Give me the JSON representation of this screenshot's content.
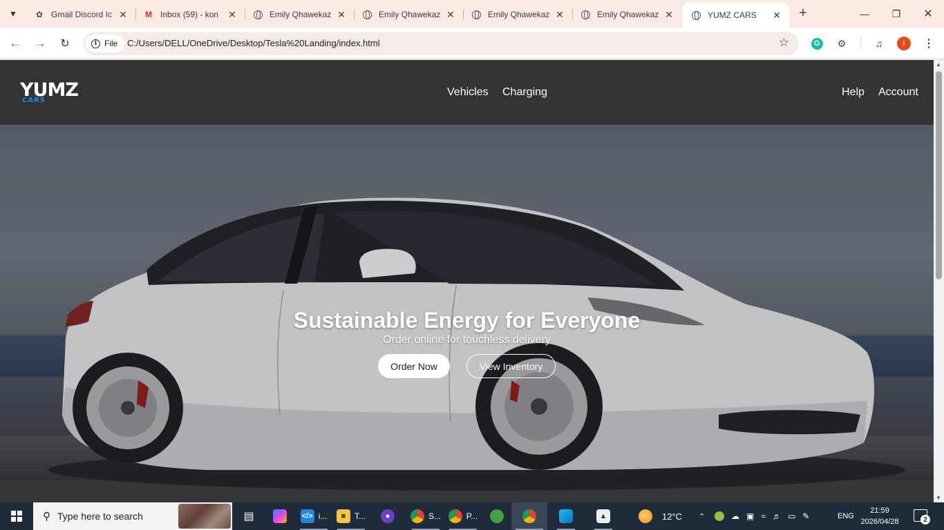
{
  "browser": {
    "tabs": [
      {
        "title": "Gmail Discord Ic",
        "icon": "chatgpt-icon"
      },
      {
        "title": "Inbox (59) - kon",
        "icon": "gmail-icon"
      },
      {
        "title": "Emily Qhawekaz",
        "icon": "globe-icon"
      },
      {
        "title": "Emily Qhawekaz",
        "icon": "globe-icon"
      },
      {
        "title": "Emily Qhawekaz",
        "icon": "globe-icon"
      },
      {
        "title": "Emily Qhawekaz",
        "icon": "globe-icon"
      },
      {
        "title": "YUMZ CARS",
        "icon": "globe-icon",
        "active": true
      }
    ],
    "omnibox": {
      "scheme_label": "File",
      "url": "C:/Users/DELL/OneDrive/Desktop/Tesla%20Landing/index.html"
    },
    "profile_initial": "I"
  },
  "site": {
    "logo": {
      "main": "YUMZ",
      "sub": "CARS"
    },
    "nav_center": [
      "Vehicles",
      "Charging"
    ],
    "nav_right": [
      "Help",
      "Account"
    ],
    "hero": {
      "title": "Sustainable Energy for Everyone",
      "subtitle": "Order online for touchless delivery",
      "primary_button": "Order Now",
      "secondary_button": "View Inventory"
    }
  },
  "taskbar": {
    "search_placeholder": "Type here to search",
    "apps": [
      {
        "name": "task-view",
        "label": ""
      },
      {
        "name": "copilot",
        "label": ""
      },
      {
        "name": "vscode",
        "label": "i..."
      },
      {
        "name": "file-explorer",
        "label": "T..."
      },
      {
        "name": "github-desktop",
        "label": ""
      },
      {
        "name": "chrome-1",
        "label": "S..."
      },
      {
        "name": "chrome-2",
        "label": "P..."
      },
      {
        "name": "frog-app",
        "label": ""
      },
      {
        "name": "chrome-active",
        "label": ""
      },
      {
        "name": "photos",
        "label": ""
      },
      {
        "name": "cube-app",
        "label": ""
      }
    ],
    "weather": "12°C",
    "language": "ENG",
    "time": "21:59",
    "date": "2026/04/28",
    "notification_count": "2"
  },
  "colors": {
    "header_bg": "#333333",
    "logo_accent": "#1e88e5",
    "tabstrip_bg": "#fbeae3",
    "taskbar_bg": "#1f2a3a"
  }
}
